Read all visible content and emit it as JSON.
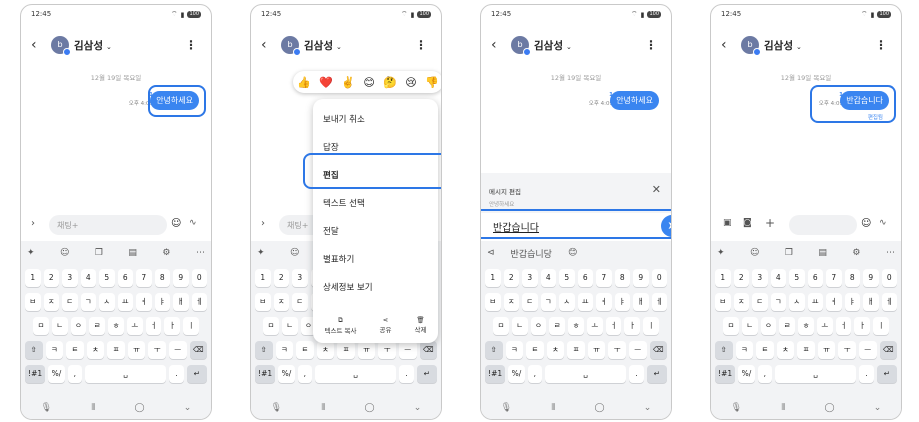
{
  "status": {
    "time": "12:45",
    "battery": "100"
  },
  "contact": {
    "initial": "b",
    "name": "김삼성"
  },
  "chat": {
    "date": "12월 19일 목요일",
    "message": "안녕하세요",
    "unread": "1",
    "time": "오후 4:09",
    "edited_message": "반갑습니다",
    "edited_label": "편집됨"
  },
  "input": {
    "placeholder": "채팅+"
  },
  "context_menu": {
    "items": [
      "보내기 취소",
      "답장",
      "편집",
      "텍스트 선택",
      "전달",
      "별표하기",
      "상세정보 보기"
    ],
    "footer": [
      "텍스트 복사",
      "공유",
      "삭제"
    ]
  },
  "reactions": [
    "👍",
    "❤️",
    "✌️",
    "😊",
    "🤔",
    "😢",
    "👎"
  ],
  "edit_panel": {
    "title": "메시지 편집",
    "original": "안녕하세요",
    "value": "반갑습니다"
  },
  "suggestion": {
    "word": "반갑습니당",
    "emoji": "😊"
  },
  "keyboard": {
    "numbers": [
      "1",
      "2",
      "3",
      "4",
      "5",
      "6",
      "7",
      "8",
      "9",
      "0"
    ],
    "row1": [
      "ㅂ",
      "ㅈ",
      "ㄷ",
      "ㄱ",
      "ㅅ",
      "ㅛ",
      "ㅕ",
      "ㅑ",
      "ㅐ",
      "ㅔ"
    ],
    "row2": [
      "ㅁ",
      "ㄴ",
      "ㅇ",
      "ㄹ",
      "ㅎ",
      "ㅗ",
      "ㅓ",
      "ㅏ",
      "ㅣ"
    ],
    "row3": [
      "ㅋ",
      "ㅌ",
      "ㅊ",
      "ㅍ",
      "ㅠ",
      "ㅜ",
      "ㅡ"
    ],
    "symbols_key": "!#1",
    "slash_key": "%/",
    "comma": ",",
    "period": "."
  }
}
